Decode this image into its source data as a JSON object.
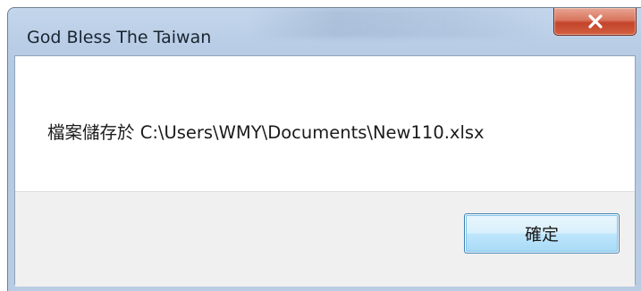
{
  "window": {
    "title": "God Bless The Taiwan",
    "close_icon": "close-x-icon"
  },
  "message": {
    "text": "檔案儲存於 C:\\Users\\WMY\\Documents\\New110.xlsx"
  },
  "buttons": {
    "ok_label": "確定"
  },
  "colors": {
    "frame": "#b9cde6",
    "close_button": "#c4442c",
    "ok_button_border": "#3c7fb1",
    "footer": "#f0f0f0"
  }
}
